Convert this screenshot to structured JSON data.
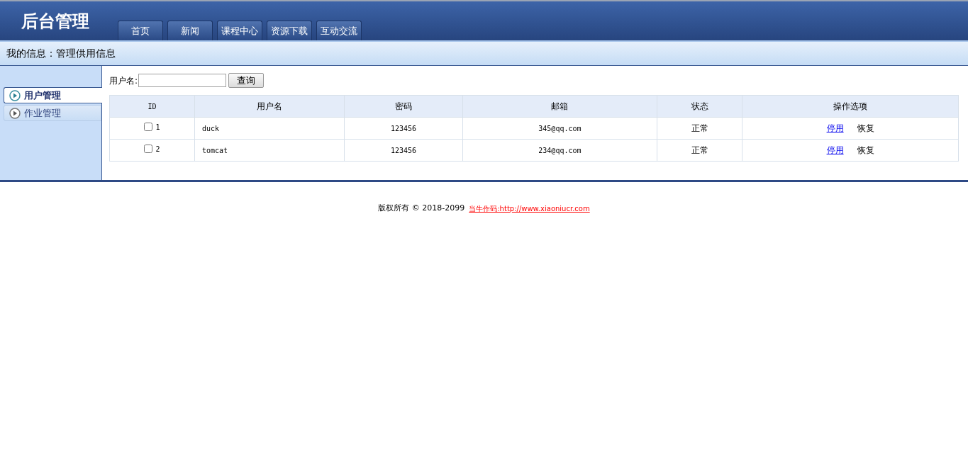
{
  "header": {
    "title": "后台管理",
    "nav": [
      "首页",
      "新闻",
      "课程中心",
      "资源下载",
      "互动交流"
    ]
  },
  "breadcrumb": "我的信息：管理供用信息",
  "sidebar": {
    "items": [
      {
        "label": "用户管理",
        "selected": true
      },
      {
        "label": "作业管理",
        "selected": false
      }
    ]
  },
  "search": {
    "label": "用户名:",
    "button": "查询"
  },
  "table": {
    "columns": [
      "ID",
      "用户名",
      "密码",
      "邮箱",
      "状态",
      "操作选项"
    ],
    "rows": [
      {
        "checked": false,
        "id": "1",
        "username": "duck",
        "password": "123456",
        "email": "345@qq.com",
        "status": "正常",
        "actions": [
          "停用",
          "恢复"
        ]
      },
      {
        "checked": false,
        "id": "2",
        "username": "tomcat",
        "password": "123456",
        "email": "234@qq.com",
        "status": "正常",
        "actions": [
          "停用",
          "恢复"
        ]
      }
    ]
  },
  "footer": {
    "text": "版权所有 © 2018-2099",
    "link": "当牛作码:http://www.xiaoniucr.com"
  }
}
